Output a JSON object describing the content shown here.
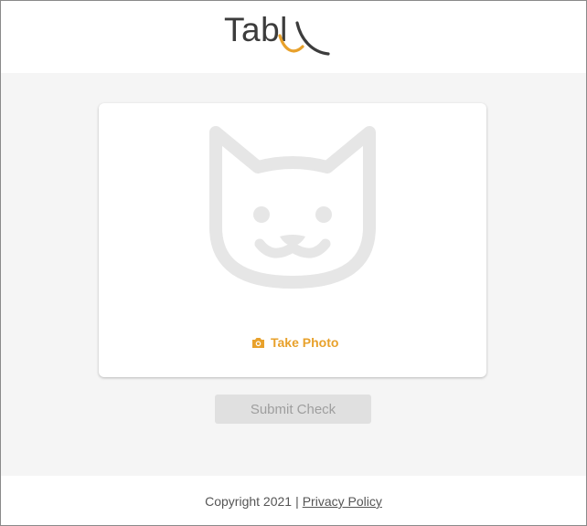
{
  "header": {
    "logo_text": "Tabl"
  },
  "card": {
    "placeholder_icon": "cat-face-icon",
    "take_photo_icon": "camera-icon",
    "take_photo_label": "Take Photo"
  },
  "submit_label": "Submit Check",
  "footer": {
    "copyright": "Copyright 2021",
    "separator": "|",
    "privacy_label": "Privacy Policy"
  },
  "colors": {
    "accent": "#e8a12b",
    "logo_text": "#3c3c3c",
    "page_background": "#f5f5f5",
    "placeholder_icon": "#e6e6e6",
    "button_disabled_background": "#e0e0e0",
    "button_disabled_text": "#9e9e9e"
  }
}
